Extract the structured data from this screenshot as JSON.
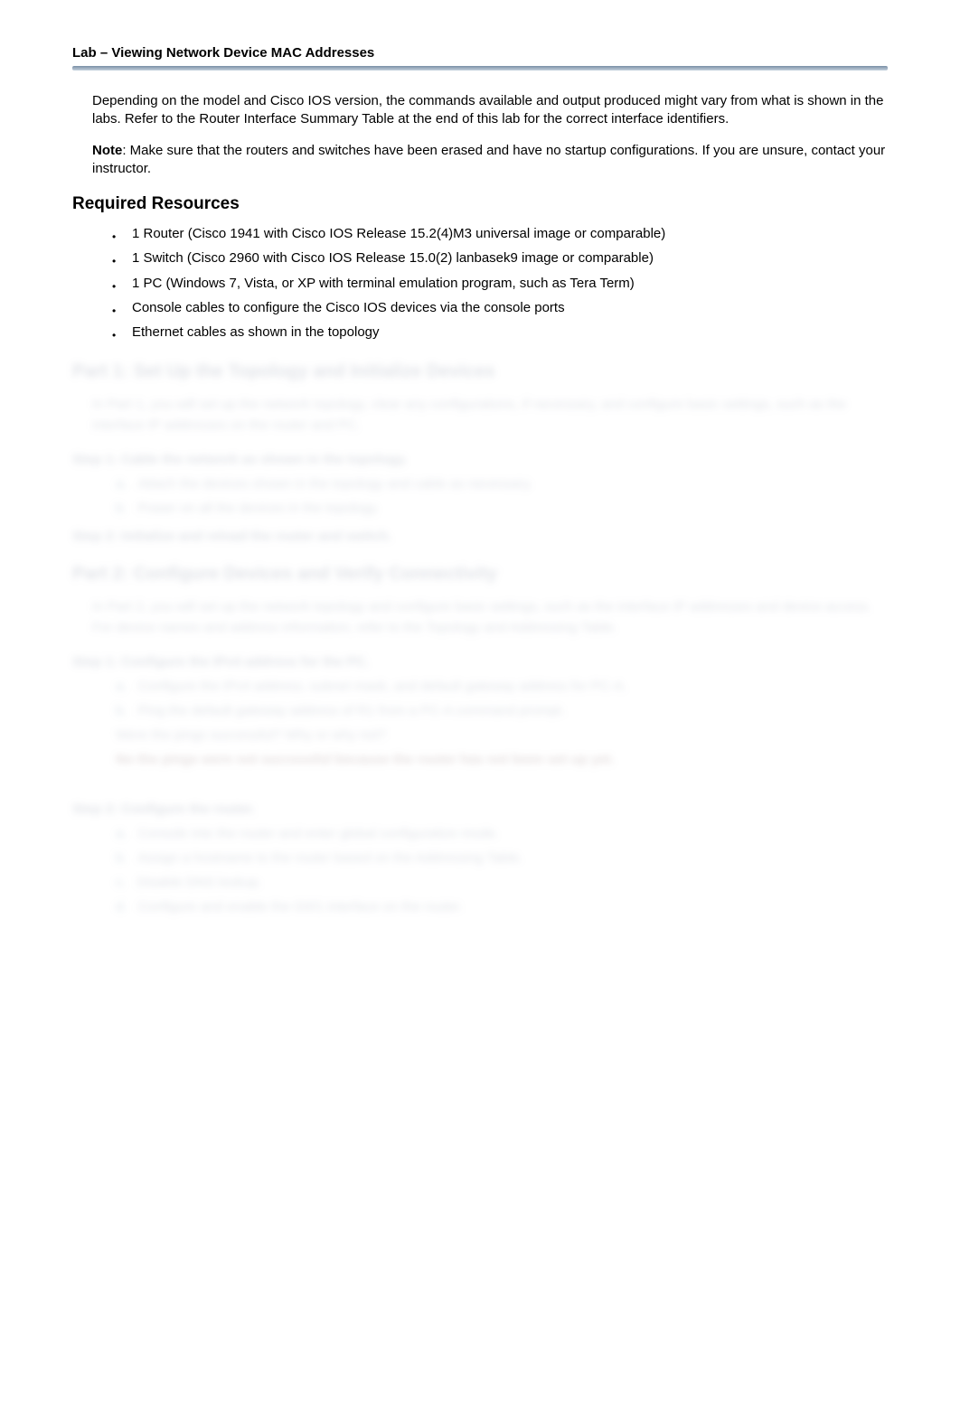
{
  "header": {
    "title": "Lab – Viewing Network Device MAC Addresses"
  },
  "paras": {
    "p1": "Depending on the model and Cisco IOS version, the commands available and output produced might vary from what is shown in the labs. Refer to the Router Interface Summary Table at the end of this lab for the correct interface identifiers.",
    "note_label": "Note",
    "p2": ": Make sure that the routers and switches have been erased and have no startup configurations. If you are unsure, contact your instructor."
  },
  "required_heading": "Required Resources",
  "bullets": [
    "1 Router (Cisco 1941 with Cisco IOS Release 15.2(4)M3 universal image or comparable)",
    "1 Switch (Cisco 2960 with Cisco IOS Release 15.0(2) lanbasek9 image or comparable)",
    "1 PC (Windows 7, Vista, or XP with terminal emulation program, such as Tera Term)",
    "Console cables to configure the Cisco IOS devices via the console ports",
    "Ethernet cables as shown in the topology"
  ],
  "blurred": {
    "part1_title": "Part 1:  Set Up the Topology and Initialize Devices",
    "part1_para": "In Part 1, you will set up the network topology, clear any configurations, if necessary, and configure basic settings, such as the interface IP addresses on the router and PC.",
    "step1": "Step 1:     Cable the network as shown in the topology.",
    "step1_a": "Attach the devices shown in the topology and cable as necessary.",
    "step1_b": "Power on all the devices in the topology.",
    "step2": "Step 2:     Initialize and reload the router and switch.",
    "part2_title": "Part 2: Configure Devices and Verify Connectivity",
    "part2_para": "In Part 2, you will set up the network topology and configure basic settings, such as the interface IP addresses and device access. For device names and address information, refer to the Topology and Addressing Table.",
    "step3": "Step 1:     Configure the IPv4 address for the PC.",
    "step3_a": "Configure the IPv4 address, subnet mask, and default gateway address for PC-A.",
    "step3_b": "Ping the default gateway address of R1 from a PC-A command prompt.",
    "step3_q": "Were the pings successful? Why or why not?",
    "step3_ans": "No the pings were not successful because the router has not been set up yet.",
    "step4": "Step 2:     Configure the router.",
    "step4_a": "Console into the router and enter global configuration mode.",
    "step4_b": "Assign a hostname to the router based on the Addressing Table.",
    "step4_c": "Disable DNS lookup.",
    "step4_d": "Configure and enable the G0/1 interface on the router."
  }
}
